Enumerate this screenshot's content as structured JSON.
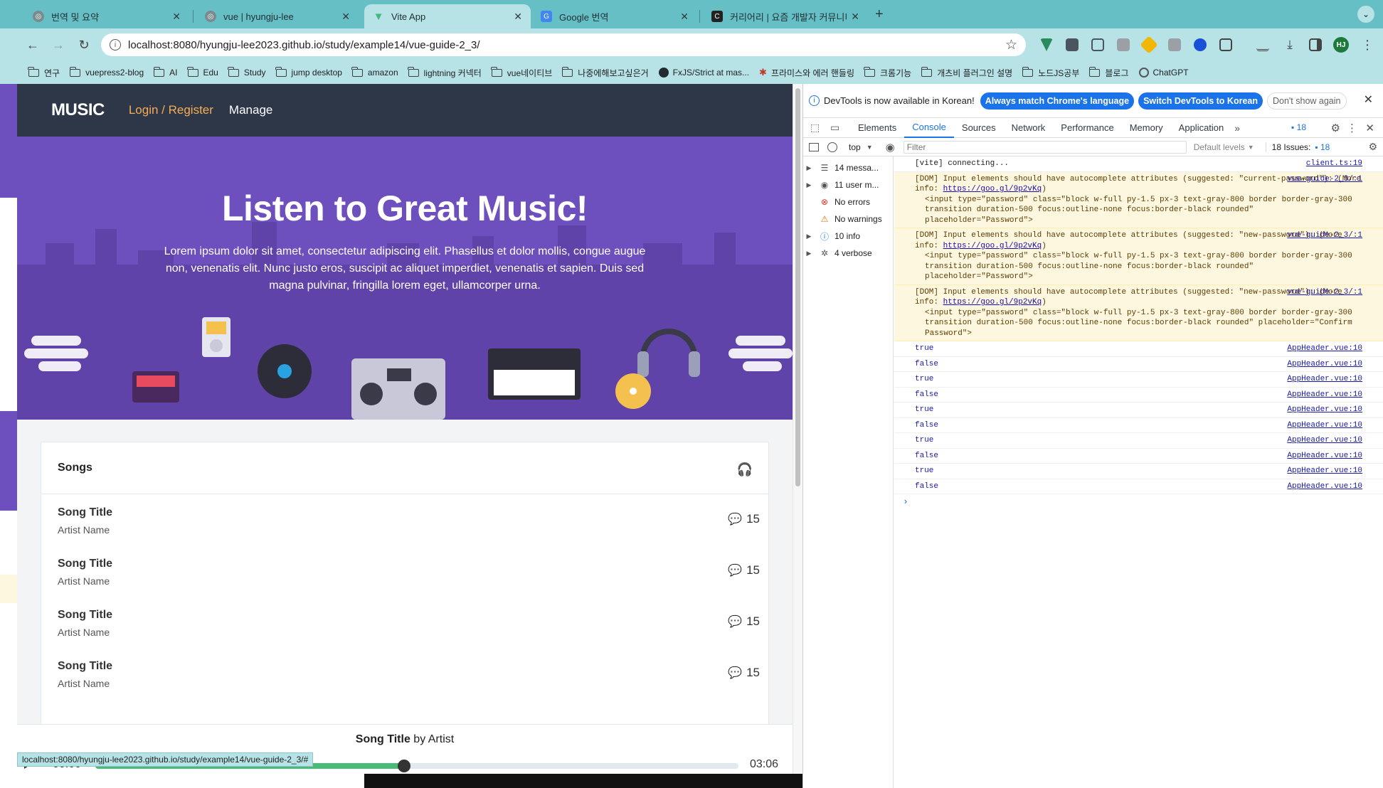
{
  "tabs": [
    {
      "title": "번역 및 요약",
      "fav_color": "#7b8a8c"
    },
    {
      "title": "vue | hyungju-lee",
      "fav_color": "#7b8a8c"
    },
    {
      "title": "Vite App",
      "fav_color": "#41b883"
    },
    {
      "title": "Google 번역",
      "fav_color": "#4285f4"
    },
    {
      "title": "커리어리 | 요즘 개발자 커뮤니티",
      "fav_color": "#222222"
    }
  ],
  "address": {
    "url": "localhost:8080/hyungju-lee2023.github.io/study/example14/vue-guide-2_3/"
  },
  "profile_initials": "HJ",
  "bookmarks": [
    "연구",
    "vuepress2-blog",
    "AI",
    "Edu",
    "Study",
    "jump desktop",
    "amazon",
    "lightning 커넥터",
    "vue네이티브",
    "나중에해보고싶은거",
    "FxJS/Strict at mas...",
    "프라미스와 에러 핸들링",
    "크롬기능",
    "개츠비 플러그인 설명",
    "노드JS공부",
    "블로그",
    "ChatGPT"
  ],
  "app": {
    "logo": "MUSIC",
    "login_link": "Login / Register",
    "manage_link": "Manage",
    "hero_title": "Listen to Great Music!",
    "hero_text": "Lorem ipsum dolor sit amet, consectetur adipiscing elit. Phasellus et dolor mollis, congue augue non, venenatis elit. Nunc justo eros, suscipit ac aliquet imperdiet, venenatis et sapien. Duis sed magna pulvinar, fringilla lorem eget, ullamcorper urna.",
    "songs_heading": "Songs",
    "songs": [
      {
        "title": "Song Title",
        "artist": "Artist Name",
        "comments": "15"
      },
      {
        "title": "Song Title",
        "artist": "Artist Name",
        "comments": "15"
      },
      {
        "title": "Song Title",
        "artist": "Artist Name",
        "comments": "15"
      },
      {
        "title": "Song Title",
        "artist": "Artist Name",
        "comments": "15"
      }
    ],
    "player": {
      "song": "Song Title",
      "by": "by Artist",
      "current": "00:00",
      "duration": "03:06",
      "progress": 0.48,
      "next_comments": "15"
    },
    "status_url": "localhost:8080/hyungju-lee2023.github.io/study/example14/vue-guide-2_3/#"
  },
  "devtools": {
    "banner": {
      "text": "DevTools is now available in Korean!",
      "btn1": "Always match Chrome's language",
      "btn2": "Switch DevTools to Korean",
      "btn3": "Don't show again"
    },
    "tabs": [
      "Elements",
      "Console",
      "Sources",
      "Network",
      "Performance",
      "Memory",
      "Application"
    ],
    "issue_count": "18",
    "context": "top",
    "filter_placeholder": "Filter",
    "levels": "Default levels",
    "issues_label": "18 Issues:",
    "issues_count": "18",
    "sidebar": [
      {
        "label": "14 messa...",
        "icon": "list-icon"
      },
      {
        "label": "11 user m...",
        "icon": "user-icon"
      },
      {
        "label": "No errors",
        "icon": "error-icon"
      },
      {
        "label": "No warnings",
        "icon": "warning-icon"
      },
      {
        "label": "10 info",
        "icon": "info-icon"
      },
      {
        "label": "4 verbose",
        "icon": "bug-icon"
      }
    ],
    "connecting": {
      "text": "[vite] connecting...",
      "src": "client.ts:19"
    },
    "warnings": [
      {
        "pre": "[DOM] Input elements should have autocomplete attributes (suggested: \"current-password\"): (More info: ",
        "link": "https://goo.gl/9p2vKq",
        "post": ")",
        "code": "<input type=\"password\" class=\"block w-full py-1.5 px-3 text-gray-800 border border-gray-300 transition duration-500 focus:outline-none focus:border-black rounded\" placeholder=\"Password\">",
        "src": "vue-guide-2_3/:1"
      },
      {
        "pre": "[DOM] Input elements should have autocomplete attributes (suggested: \"new-password\"): (More info: ",
        "link": "https://goo.gl/9p2vKq",
        "post": ")",
        "code": "<input type=\"password\" class=\"block w-full py-1.5 px-3 text-gray-800 border border-gray-300 transition duration-500 focus:outline-none focus:border-black rounded\" placeholder=\"Password\">",
        "src": "vue-guide-2_3/:1"
      },
      {
        "pre": "[DOM] Input elements should have autocomplete attributes (suggested: \"new-password\"): (More info: ",
        "link": "https://goo.gl/9p2vKq",
        "post": ")",
        "code": "<input type=\"password\" class=\"block w-full py-1.5 px-3 text-gray-800 border border-gray-300 transition duration-500 focus:outline-none focus:border-black rounded\" placeholder=\"Confirm Password\">",
        "src": "vue-guide-2_3/:1"
      }
    ],
    "logs": [
      {
        "v": "true",
        "src": "AppHeader.vue:10"
      },
      {
        "v": "false",
        "src": "AppHeader.vue:10"
      },
      {
        "v": "true",
        "src": "AppHeader.vue:10"
      },
      {
        "v": "false",
        "src": "AppHeader.vue:10"
      },
      {
        "v": "true",
        "src": "AppHeader.vue:10"
      },
      {
        "v": "false",
        "src": "AppHeader.vue:10"
      },
      {
        "v": "true",
        "src": "AppHeader.vue:10"
      },
      {
        "v": "false",
        "src": "AppHeader.vue:10"
      },
      {
        "v": "true",
        "src": "AppHeader.vue:10"
      },
      {
        "v": "false",
        "src": "AppHeader.vue:10"
      }
    ]
  },
  "colors": {
    "tab_bar": "#67bfc6",
    "toolbar": "#b7e3e6",
    "header": "#2d3748",
    "hero": "#6d4fbd",
    "accent": "#f6ad55",
    "progress": "#48bb78",
    "devtools_blue": "#1a73e8"
  }
}
